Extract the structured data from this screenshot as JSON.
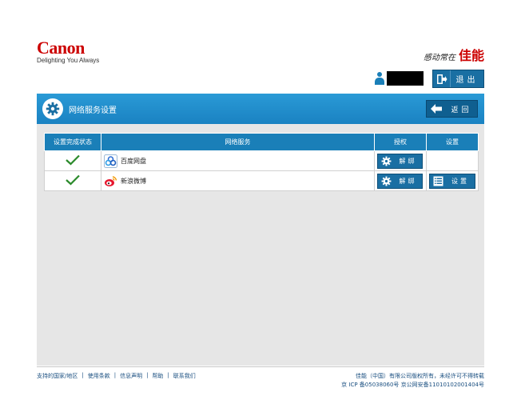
{
  "header": {
    "logo_text": "Canon",
    "logo_tagline": "Delighting You Always",
    "slogan_small": "感动常在",
    "slogan_big": "佳能",
    "user_name": "",
    "logout_label": "退出"
  },
  "panel": {
    "title": "网络服务设置",
    "back_label": "返回",
    "columns": [
      "设置完成状态",
      "网络服务",
      "授权",
      "设置"
    ],
    "rows": [
      {
        "status": "complete",
        "service": "百度网盘",
        "service_icon": "baidu-netdisk-icon",
        "auth_label": "解绑",
        "setting_label": ""
      },
      {
        "status": "complete",
        "service": "新浪微博",
        "service_icon": "sina-weibo-icon",
        "auth_label": "解绑",
        "setting_label": "设置"
      }
    ]
  },
  "footer": {
    "links": [
      "支持的国家/地区",
      "使用条款",
      "信息声明",
      "帮助",
      "联系我们"
    ],
    "copyright": "佳能（中国）有限公司版权所有，未经许可不得转载",
    "icp": "京 ICP 备05038060号 京公网安备110101020014​04号"
  },
  "colors": {
    "brand_red": "#cc0000",
    "accent_blue": "#1a7fb8",
    "check_green": "#2a8a2a"
  }
}
